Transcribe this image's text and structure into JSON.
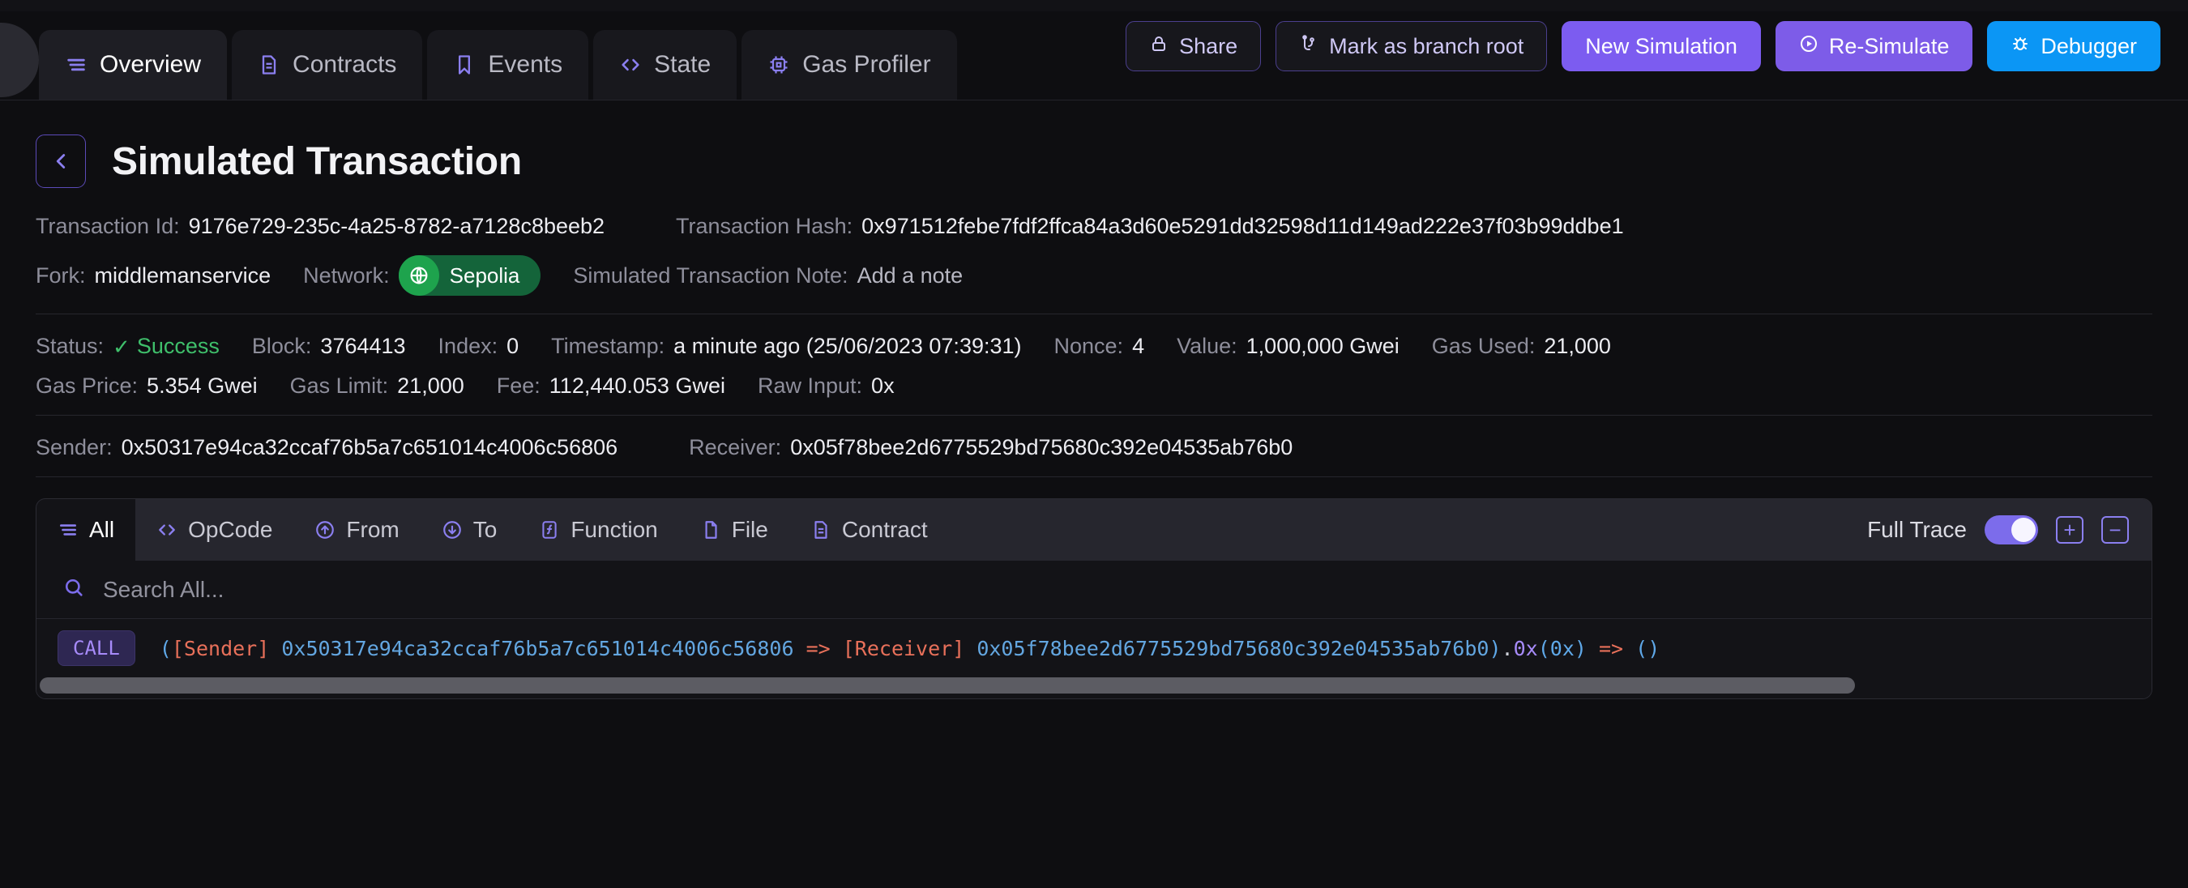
{
  "topbar": {
    "tabs": [
      {
        "label": "Overview",
        "icon": "list-icon",
        "active": true
      },
      {
        "label": "Contracts",
        "icon": "file-text-icon",
        "active": false
      },
      {
        "label": "Events",
        "icon": "bookmark-icon",
        "active": false
      },
      {
        "label": "State",
        "icon": "code-brackets-icon",
        "active": false
      },
      {
        "label": "Gas Profiler",
        "icon": "chip-icon",
        "active": false
      }
    ],
    "actions": [
      {
        "label": "Share",
        "icon": "lock-icon",
        "style": "outline"
      },
      {
        "label": "Mark as branch root",
        "icon": "branch-icon",
        "style": "outline"
      },
      {
        "label": "New Simulation",
        "icon": "",
        "style": "purple"
      },
      {
        "label": "Re-Simulate",
        "icon": "play-circle-icon",
        "style": "purple2"
      },
      {
        "label": "Debugger",
        "icon": "bug-icon",
        "style": "blue"
      }
    ]
  },
  "page": {
    "back_label": "←",
    "title": "Simulated Transaction"
  },
  "meta": {
    "transaction_id_label": "Transaction Id:",
    "transaction_id": "9176e729-235c-4a25-8782-a7128c8beeb2",
    "transaction_hash_label": "Transaction Hash:",
    "transaction_hash": "0x971512febe7fdf2ffca84a3d60e5291dd32598d11d149ad222e37f03b99ddbe1",
    "fork_label": "Fork:",
    "fork": "middlemanservice",
    "network_label": "Network:",
    "network": "Sepolia",
    "note_label": "Simulated Transaction Note:",
    "note_placeholder": "Add a note",
    "status_label": "Status:",
    "status": "Success",
    "status_check": "✓",
    "block_label": "Block:",
    "block": "3764413",
    "index_label": "Index:",
    "index": "0",
    "timestamp_label": "Timestamp:",
    "timestamp": "a minute ago (25/06/2023 07:39:31)",
    "nonce_label": "Nonce:",
    "nonce": "4",
    "value_label": "Value:",
    "value": "1,000,000 Gwei",
    "gas_used_label": "Gas Used:",
    "gas_used": "21,000",
    "gas_price_label": "Gas Price:",
    "gas_price": "5.354 Gwei",
    "gas_limit_label": "Gas Limit:",
    "gas_limit": "21,000",
    "fee_label": "Fee:",
    "fee": "112,440.053 Gwei",
    "raw_input_label": "Raw Input:",
    "raw_input": "0x",
    "sender_label": "Sender:",
    "sender": "0x50317e94ca32ccaf76b5a7c651014c4006c56806",
    "receiver_label": "Receiver:",
    "receiver": "0x05f78bee2d6775529bd75680c392e04535ab76b0"
  },
  "trace": {
    "tabs": [
      {
        "label": "All",
        "icon": "list-icon",
        "active": true
      },
      {
        "label": "OpCode",
        "icon": "code-brackets-icon",
        "active": false
      },
      {
        "label": "From",
        "icon": "arrow-up-circle-icon",
        "active": false
      },
      {
        "label": "To",
        "icon": "arrow-down-circle-icon",
        "active": false
      },
      {
        "label": "Function",
        "icon": "function-icon",
        "active": false
      },
      {
        "label": "File",
        "icon": "file-icon",
        "active": false
      },
      {
        "label": "Contract",
        "icon": "file-text-icon",
        "active": false
      }
    ],
    "full_trace_label": "Full Trace",
    "full_trace_on": true,
    "expand_label": "+",
    "collapse_label": "−",
    "search_placeholder": "Search All...",
    "rows": [
      {
        "type": "CALL",
        "open_paren": "(",
        "from_tag": "[Sender]",
        "from_addr": "0x50317e94ca32ccaf76b5a7c651014c4006c56806",
        "arrow": "=>",
        "to_tag": "[Receiver]",
        "to_addr": "0x05f78bee2d6775529bd75680c392e04535ab76b0",
        "close_paren": ")",
        "dot": ".",
        "fn": "0x",
        "args": "(0x)",
        "ret_arrow": "=>",
        "ret": "()"
      }
    ]
  },
  "colors": {
    "accent_purple": "#7c5cf0",
    "accent_blue": "#0b96f5",
    "success_green": "#3fbf6b",
    "network_green": "#1ea34d"
  }
}
